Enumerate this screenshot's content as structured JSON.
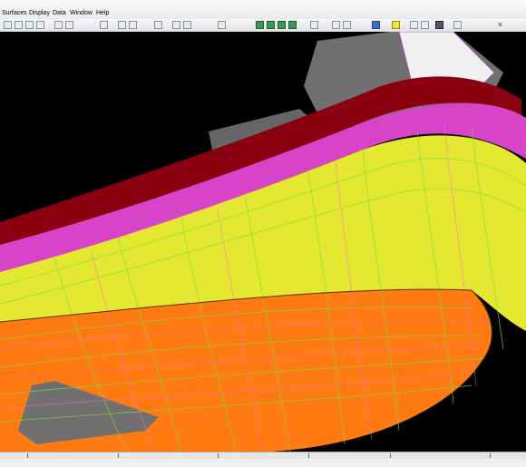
{
  "window": {
    "menu": [
      {
        "label": "Surfaces"
      },
      {
        "label": "Display"
      },
      {
        "label": "Data"
      },
      {
        "label": "Window"
      },
      {
        "label": "Help"
      }
    ],
    "close_glyph": "×"
  },
  "toolbar": {
    "icons": [
      "select-icon",
      "zoom-icon",
      "pan-icon",
      "rotate-icon",
      "line-icon",
      "curve-icon",
      "surface-icon",
      "grid-icon",
      "mesh-icon",
      "shade-icon",
      "view-front-icon",
      "view-side-icon",
      "view-top-icon",
      "render-icon",
      "light-icon",
      "color-icon"
    ]
  },
  "viewport": {
    "background": "#000000",
    "hull_colors": {
      "topside": "#e4e830",
      "bottom": "#ff7a10",
      "deck_edge": "#e040d0",
      "bulwark": "#8a0010",
      "superstructure": "#707070",
      "grid_lines": "#7adc40"
    }
  }
}
